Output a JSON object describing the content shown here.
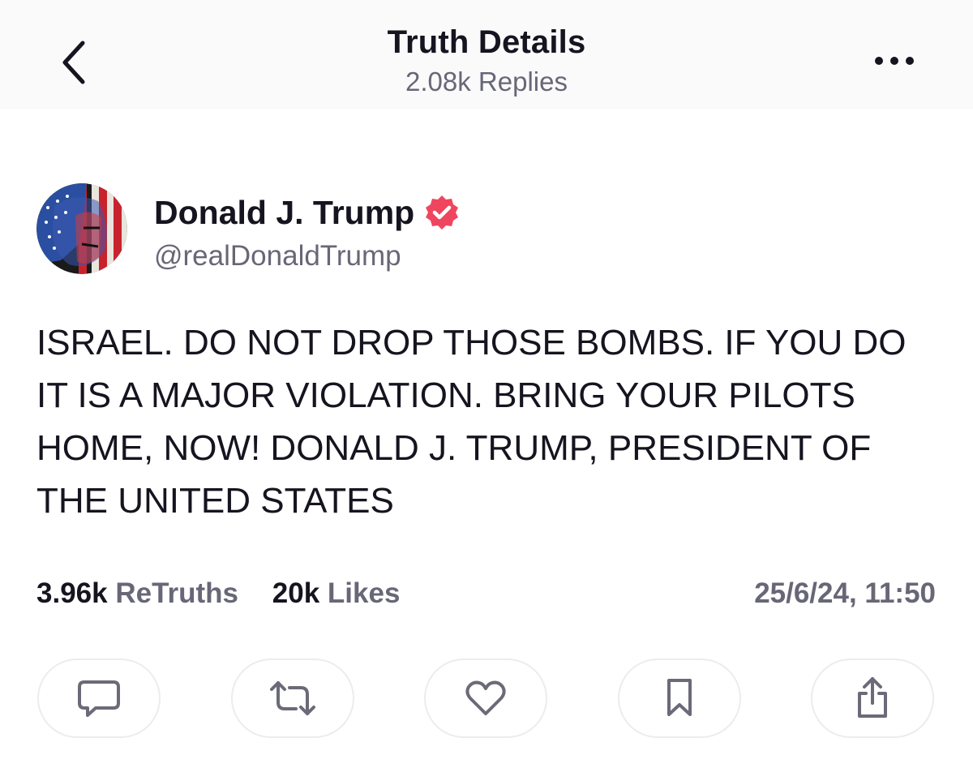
{
  "header": {
    "title": "Truth Details",
    "replies": "2.08k Replies",
    "back_icon": "chevron-left-icon",
    "more_icon": "ellipsis-icon"
  },
  "author": {
    "name": "Donald J. Trump",
    "handle": "@realDonaldTrump",
    "verified_color": "#f0455e"
  },
  "post": {
    "text": "ISRAEL. DO NOT DROP THOSE BOMBS. IF YOU DO IT IS A MAJOR VIOLATION. BRING YOUR PILOTS HOME, NOW! DONALD J. TRUMP, PRESIDENT OF THE UNITED STATES"
  },
  "stats": {
    "retruths_count": "3.96k",
    "retruths_label": "ReTruths",
    "likes_count": "20k",
    "likes_label": "Likes",
    "timestamp": "25/6/24, 11:50"
  },
  "actions": [
    {
      "icon": "reply-icon"
    },
    {
      "icon": "retruth-icon"
    },
    {
      "icon": "like-icon"
    },
    {
      "icon": "bookmark-icon"
    },
    {
      "icon": "share-icon"
    }
  ],
  "colors": {
    "text": "#15141f",
    "muted": "#686777",
    "accent": "#f0455e"
  }
}
